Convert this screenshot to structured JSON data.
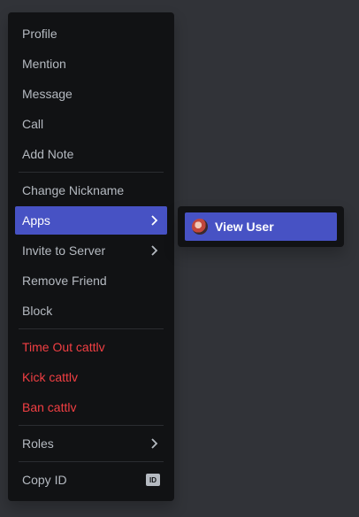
{
  "menu": {
    "profile": "Profile",
    "mention": "Mention",
    "message": "Message",
    "call": "Call",
    "add_note": "Add Note",
    "change_nickname": "Change Nickname",
    "apps": "Apps",
    "invite_to_server": "Invite to Server",
    "remove_friend": "Remove Friend",
    "block": "Block",
    "time_out": "Time Out cattlv",
    "kick": "Kick cattlv",
    "ban": "Ban cattlv",
    "roles": "Roles",
    "copy_id": "Copy ID",
    "id_badge": "ID"
  },
  "submenu": {
    "view_user": "View User"
  },
  "icons": {
    "chevron": "chevron-right-icon",
    "id": "id-badge-icon",
    "avatar": "user-avatar"
  },
  "colors": {
    "background": "#313338",
    "menu_bg": "#111214",
    "accent": "#4752c4",
    "danger": "#f23f43",
    "text": "#b5bac1"
  }
}
